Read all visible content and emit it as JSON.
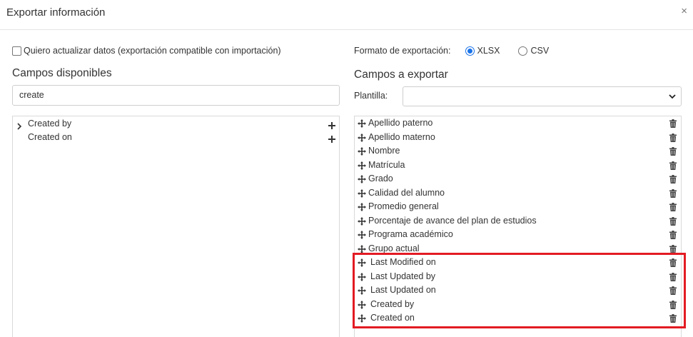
{
  "dialog": {
    "title": "Exportar información",
    "close_icon": "×"
  },
  "options": {
    "update_checkbox_label": "Quiero actualizar datos (exportación compatible con importación)",
    "update_checked": false
  },
  "left": {
    "title": "Campos disponibles",
    "search_value": "create",
    "items": [
      {
        "label": "Created by",
        "expandable": true
      },
      {
        "label": "Created on",
        "expandable": false
      }
    ]
  },
  "right": {
    "format_label": "Formato de exportación:",
    "formats": [
      {
        "label": "XLSX",
        "selected": true
      },
      {
        "label": "CSV",
        "selected": false
      }
    ],
    "title": "Campos a exportar",
    "plantilla_label": "Plantilla:",
    "plantilla_value": "",
    "items": [
      {
        "label": "Apellido paterno"
      },
      {
        "label": "Apellido materno"
      },
      {
        "label": "Nombre"
      },
      {
        "label": "Matrícula"
      },
      {
        "label": "Grado"
      },
      {
        "label": "Calidad del alumno"
      },
      {
        "label": "Promedio general"
      },
      {
        "label": "Porcentaje de avance del plan de estudios"
      },
      {
        "label": "Programa académico"
      },
      {
        "label": "Grupo actual"
      },
      {
        "label": "Last Modified on"
      },
      {
        "label": "Last Updated by"
      },
      {
        "label": "Last Updated on"
      },
      {
        "label": "Created by"
      },
      {
        "label": "Created on"
      }
    ]
  },
  "colors": {
    "highlight": "#e31b23",
    "radio_accent": "#1a73e8"
  }
}
